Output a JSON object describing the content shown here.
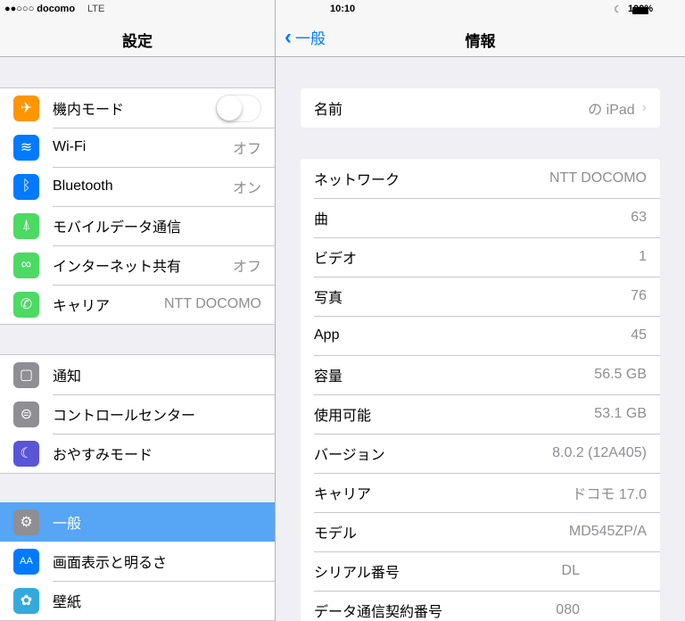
{
  "status": {
    "carrier": "●●○○○ docomo",
    "network": "LTE",
    "time": "10:10",
    "moon": "☾",
    "battery": "100%"
  },
  "left": {
    "title": "設定",
    "group1": [
      {
        "label": "機内モード",
        "value": "",
        "icon": "airplane-icon",
        "color": "#ff9500",
        "glyph": "✈"
      },
      {
        "label": "Wi-Fi",
        "value": "オフ",
        "icon": "wifi-icon",
        "color": "#007aff",
        "glyph": "≋"
      },
      {
        "label": "Bluetooth",
        "value": "オン",
        "icon": "bluetooth-icon",
        "color": "#007aff",
        "glyph": "ᛒ"
      },
      {
        "label": "モバイルデータ通信",
        "value": "",
        "icon": "cellular-icon",
        "color": "#4cd964",
        "glyph": "⍋"
      },
      {
        "label": "インターネット共有",
        "value": "オフ",
        "icon": "hotspot-icon",
        "color": "#4cd964",
        "glyph": "∞"
      },
      {
        "label": "キャリア",
        "value": "NTT DOCOMO",
        "icon": "phone-icon",
        "color": "#4cd964",
        "glyph": "✆"
      }
    ],
    "group2": [
      {
        "label": "通知",
        "icon": "notifications-icon",
        "color": "#8e8e93",
        "glyph": "▢"
      },
      {
        "label": "コントロールセンター",
        "icon": "control-center-icon",
        "color": "#8e8e93",
        "glyph": "⊜"
      },
      {
        "label": "おやすみモード",
        "icon": "moon-icon",
        "color": "#5856d6",
        "glyph": "☾"
      }
    ],
    "group3": [
      {
        "label": "一般",
        "icon": "gear-icon",
        "color": "#8e8e93",
        "glyph": "⚙"
      },
      {
        "label": "画面表示と明るさ",
        "icon": "display-icon",
        "color": "#007aff",
        "glyph": "AA"
      },
      {
        "label": "壁紙",
        "icon": "wallpaper-icon",
        "color": "#34aadc",
        "glyph": "✿"
      }
    ]
  },
  "right": {
    "back": "一般",
    "title": "情報",
    "name": {
      "label": "名前",
      "value": "の iPad"
    },
    "rows": [
      {
        "label": "ネットワーク",
        "value": "NTT DOCOMO"
      },
      {
        "label": "曲",
        "value": "63"
      },
      {
        "label": "ビデオ",
        "value": "1"
      },
      {
        "label": "写真",
        "value": "76"
      },
      {
        "label": "App",
        "value": "45"
      },
      {
        "label": "容量",
        "value": "56.5 GB"
      },
      {
        "label": "使用可能",
        "value": "53.1 GB"
      },
      {
        "label": "バージョン",
        "value": "8.0.2 (12A405)"
      },
      {
        "label": "キャリア",
        "value": "ドコモ 17.0"
      },
      {
        "label": "モデル",
        "value": "MD545ZP/A"
      },
      {
        "label": "シリアル番号",
        "value": "DL"
      },
      {
        "label": "データ通信契約番号",
        "value": "080"
      }
    ]
  }
}
